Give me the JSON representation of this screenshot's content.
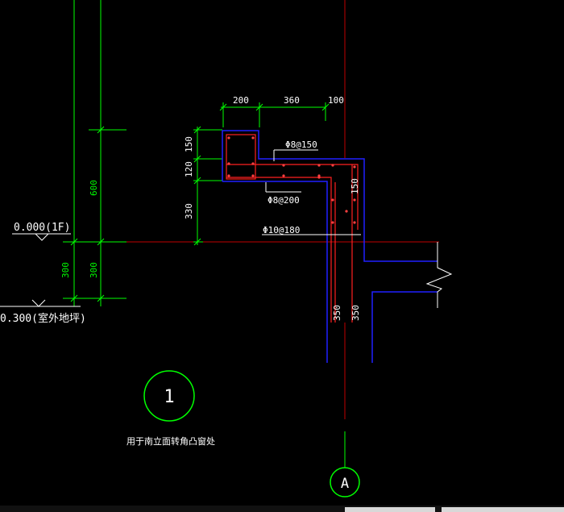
{
  "colors": {
    "background": "#000000",
    "dimension": "#00ff00",
    "axis_red": "#c00000",
    "concrete_blue": "#2020ff",
    "rebar_red": "#ff2020",
    "label_white": "#ffffff"
  },
  "dimensions": {
    "top": [
      "200",
      "360",
      "100"
    ],
    "left_section": [
      "150",
      "120",
      "330"
    ],
    "left_span": "600",
    "left_lower_outer": "300",
    "left_lower_inner": "300",
    "column_right": "150",
    "wall_left": "350",
    "wall_right": "350"
  },
  "rebar": {
    "top_bar": "Φ8@150",
    "lower_bar": "Φ8@200",
    "wall_bar": "Φ10@180"
  },
  "elevations": {
    "floor": "0.000(1F)",
    "outdoor": "0.300(室外地坪)"
  },
  "detail": {
    "number": "1",
    "caption": "用于南立面转角凸窗处"
  },
  "axis": {
    "label": "A"
  }
}
